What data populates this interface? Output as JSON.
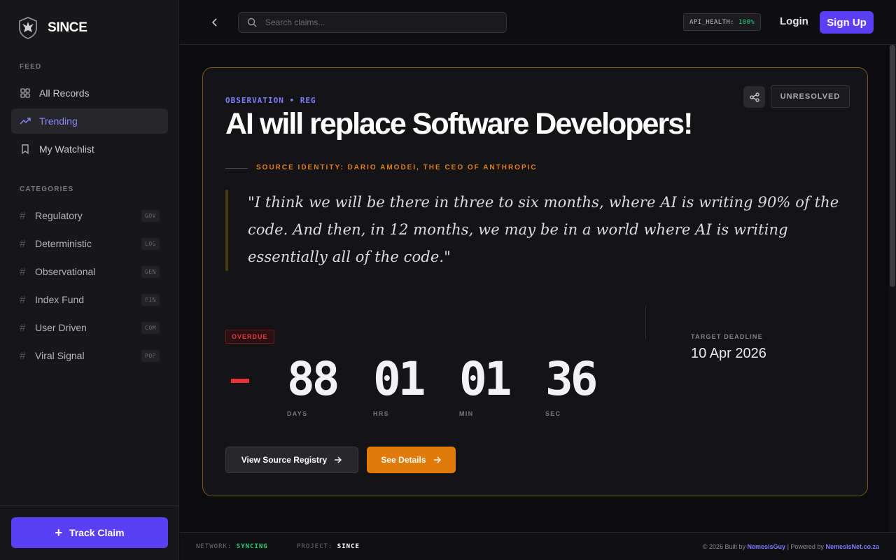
{
  "brand": {
    "name": "SINCE"
  },
  "sidebar": {
    "feed_label": "FEED",
    "feed": [
      {
        "label": "All Records",
        "icon": "grid-icon",
        "active": false
      },
      {
        "label": "Trending",
        "icon": "trending-icon",
        "active": true
      },
      {
        "label": "My Watchlist",
        "icon": "bookmark-icon",
        "active": false
      }
    ],
    "categories_label": "CATEGORIES",
    "categories": [
      {
        "label": "Regulatory",
        "tag": "GOV"
      },
      {
        "label": "Deterministic",
        "tag": "LOG"
      },
      {
        "label": "Observational",
        "tag": "GEN"
      },
      {
        "label": "Index Fund",
        "tag": "FIN"
      },
      {
        "label": "User Driven",
        "tag": "COM"
      },
      {
        "label": "Viral Signal",
        "tag": "POP"
      }
    ],
    "track_button": "Track Claim"
  },
  "topbar": {
    "search_placeholder": "Search claims...",
    "api_label": "API_HEALTH:",
    "api_value": "100%",
    "login": "Login",
    "signup": "Sign Up"
  },
  "claim": {
    "eyebrow": "OBSERVATION • REG",
    "title": "AI will replace Software Developers!",
    "status": "UNRESOLVED",
    "source": "SOURCE IDENTITY: DARIO AMODEI, THE CEO OF ANTHROPIC",
    "quote": "\"I think we will be there in three to six months, where AI is writing 90% of the code. And then, in 12 months, we may be in a world where AI is writing essentially all of the code.\"",
    "overdue": "OVERDUE",
    "sign": "-",
    "countdown": {
      "days": "88",
      "hrs": "01",
      "min": "01",
      "sec": "36",
      "days_label": "DAYS",
      "hrs_label": "HRS",
      "min_label": "MIN",
      "sec_label": "SEC"
    },
    "deadline_label": "TARGET DEADLINE",
    "deadline": "10 Apr 2026",
    "btn_source": "View Source Registry",
    "btn_details": "See Details"
  },
  "footer": {
    "network_label": "NETWORK:",
    "network_value": "SYNCING",
    "project_label": "PROJECT:",
    "project_value": "SINCE",
    "built_prefix": "© 2026 Built by",
    "built_by": "NemesisGuy",
    "powered_prefix": "| Powered by",
    "powered_by": "NemesisNet.co.za"
  },
  "colors": {
    "accent": "#5b3ff5",
    "orange": "#e07a09",
    "overdue_red": "#e33d3d",
    "healthy_green": "#26d07c",
    "card_border": "#7a5a1a"
  }
}
